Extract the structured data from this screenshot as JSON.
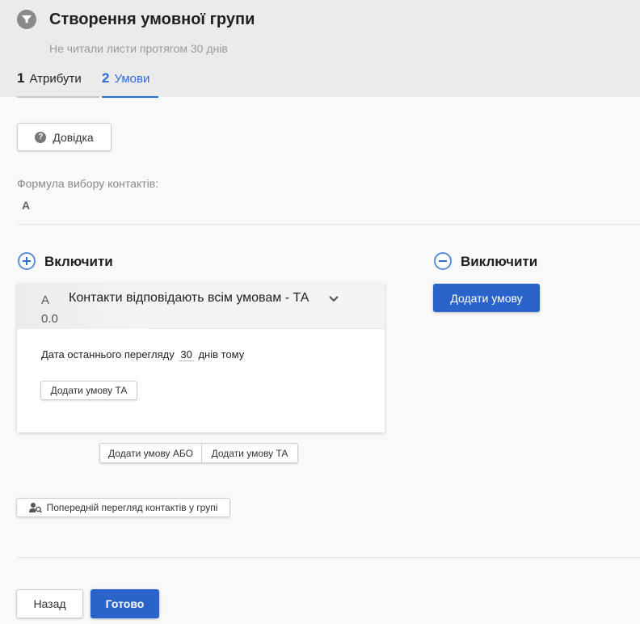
{
  "header": {
    "title": "Створення умовної групи",
    "subtitle": "Не читали листи протягом 30 днів",
    "tabs": [
      {
        "num": "1",
        "label": "Атрибути",
        "active": false
      },
      {
        "num": "2",
        "label": "Умови",
        "active": true
      }
    ]
  },
  "help_button": {
    "label": "Довідка",
    "icon": "question-circle-icon"
  },
  "formula": {
    "label": "Формула вибору контактів:",
    "value": "A"
  },
  "include": {
    "title": "Включити",
    "icon": "plus-circle-icon",
    "condition_group": {
      "id_line1": "A",
      "id_line2": "0.0",
      "title": "Контакти відповідають всім умовам - ТА",
      "condition": {
        "prefix": "Дата останнього перегляду",
        "value": "30",
        "suffix": "днів тому"
      },
      "add_and_label": "Додати умову ТА"
    },
    "add_or_label": "Додати умову АБО",
    "add_and_label": "Додати умову ТА"
  },
  "exclude": {
    "title": "Виключити",
    "icon": "minus-circle-icon",
    "add_condition_label": "Додати умову"
  },
  "preview_button": {
    "label": "Попередній перегляд контактів у групі",
    "icon": "user-search-icon"
  },
  "footer": {
    "back_label": "Назад",
    "done_label": "Готово"
  },
  "colors": {
    "accent": "#2a63c9",
    "header_bg": "#ebebeb"
  }
}
